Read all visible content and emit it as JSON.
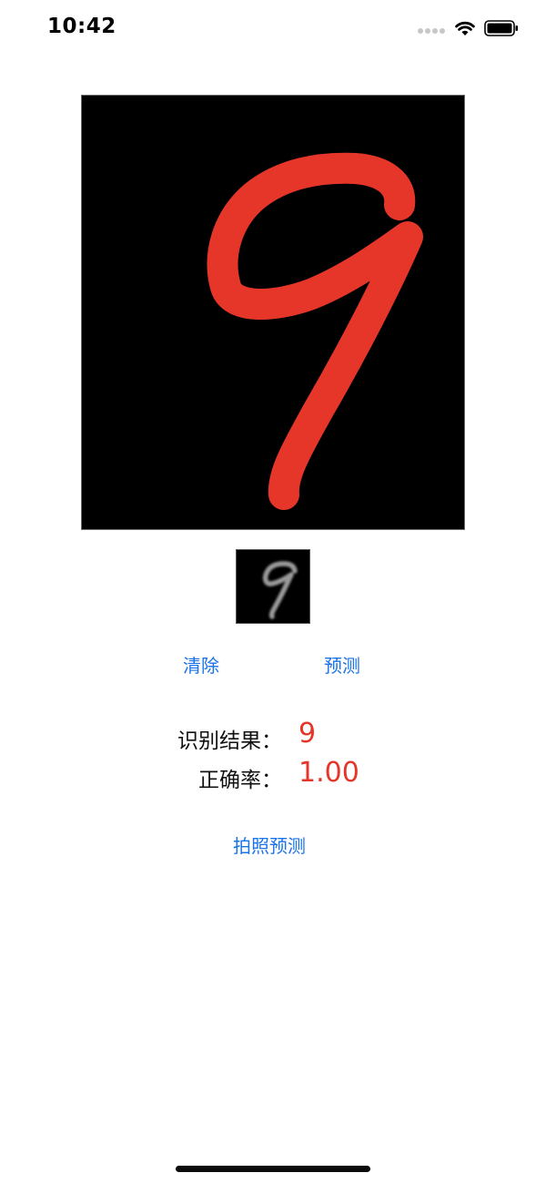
{
  "status_bar": {
    "time": "10:42"
  },
  "canvas": {
    "background_color": "#000000",
    "stroke_color": "#e6362a",
    "drawn_digit_icon": "handwritten-nine"
  },
  "preview": {
    "thumbnail_icon": "grayscale-nine"
  },
  "buttons": {
    "clear_label": "清除",
    "predict_label": "预测",
    "photo_predict_label": "拍照预测"
  },
  "results": {
    "result_label": "识别结果：",
    "result_value": "9",
    "accuracy_label": "正确率：",
    "accuracy_value": "1.00"
  },
  "colors": {
    "accent": "#1a73e8",
    "result": "#e6362a"
  }
}
